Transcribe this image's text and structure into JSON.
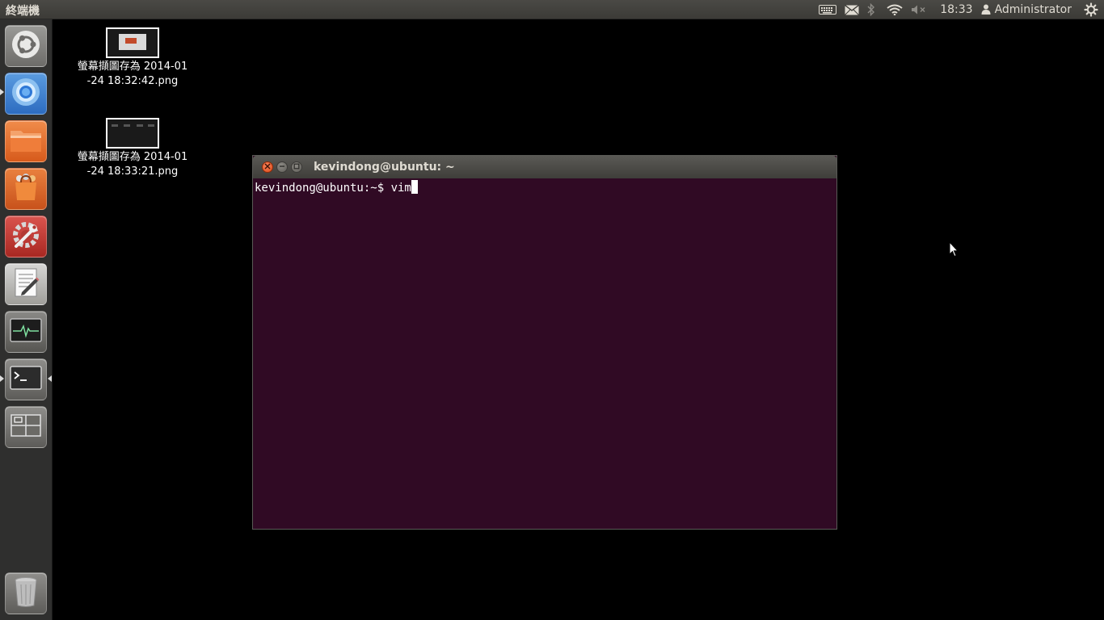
{
  "panel": {
    "app_title": "終端機",
    "clock": "18:33",
    "user": "Administrator",
    "icons": [
      "keyboard-icon",
      "mail-icon",
      "bluetooth-icon",
      "wifi-icon",
      "volume-muted-icon",
      "user-icon",
      "gear-icon"
    ]
  },
  "launcher": {
    "items": [
      {
        "name": "dash-home",
        "icon": "ubuntu-logo-icon"
      },
      {
        "name": "chromium",
        "icon": "chromium-icon"
      },
      {
        "name": "files",
        "icon": "folder-icon"
      },
      {
        "name": "software-center",
        "icon": "shopping-bag-icon"
      },
      {
        "name": "system-settings",
        "icon": "settings-wrench-icon"
      },
      {
        "name": "text-editor",
        "icon": "text-editor-icon"
      },
      {
        "name": "system-monitor",
        "icon": "system-monitor-icon"
      },
      {
        "name": "terminal",
        "icon": "terminal-icon"
      },
      {
        "name": "workspace-switcher",
        "icon": "workspace-icon"
      },
      {
        "name": "trash",
        "icon": "trash-icon"
      }
    ]
  },
  "desktop": {
    "files": [
      {
        "label": "螢幕擷圖存為 2014-01-24 18:32:42.png"
      },
      {
        "label": "螢幕擷圖存為 2014-01-24 18:33:21.png"
      }
    ]
  },
  "terminal": {
    "title": "kevindong@ubuntu: ~",
    "prompt": "kevindong@ubuntu:~$ ",
    "command": "vim"
  },
  "colors": {
    "terminal_bg": "#300a24",
    "panel_bg": "#3c3b37",
    "launcher_bg": "#2f2f2e",
    "close_button": "#df4a16"
  }
}
